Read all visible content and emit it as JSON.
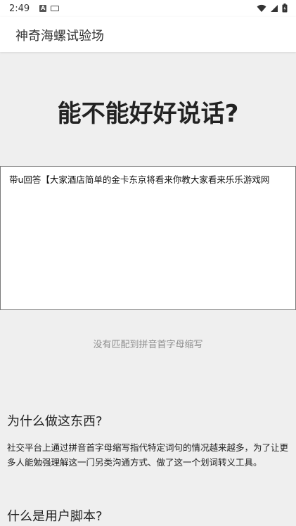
{
  "status_bar": {
    "time": "2:49",
    "icons": [
      "notification-a-icon",
      "keyboard-icon",
      "wifi-icon",
      "cellular-signal-icon",
      "battery-icon"
    ]
  },
  "app_bar": {
    "title": "神奇海螺试验场"
  },
  "hero": {
    "title": "能不能好好说话?"
  },
  "input": {
    "value": "带u回答【大家酒店简单的金卡东京将看来你教大家看来乐乐游戏网"
  },
  "result": {
    "text": "没有匹配到拼音首字母缩写"
  },
  "sections": [
    {
      "heading": "为什么做这东西?",
      "body": "社交平台上通过拼音首字母缩写指代特定词句的情况越来越多，为了让更多人能勉强理解这一门另类沟通方式、做了这一个划词转义工具。"
    },
    {
      "heading": "什么是用户脚本?"
    }
  ]
}
